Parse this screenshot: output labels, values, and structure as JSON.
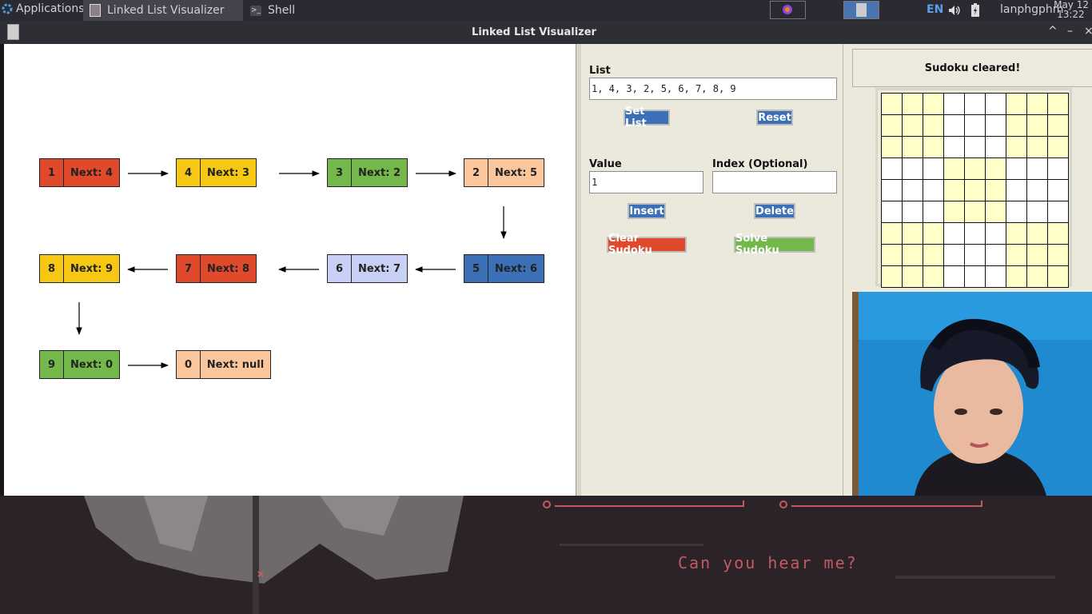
{
  "taskbar": {
    "apps_label": "Applications",
    "tasks": [
      {
        "label": "Linked List Visualizer"
      },
      {
        "label": "Shell"
      }
    ],
    "lang": "EN",
    "user": "lanphgphm",
    "date": "May 12",
    "time": "13:22"
  },
  "window": {
    "title": "Linked List Visualizer",
    "controls": [
      "^",
      "–",
      "×"
    ]
  },
  "canvas": {
    "nodes": [
      {
        "value": "1",
        "next": "Next: 4",
        "color": "#e0492c"
      },
      {
        "value": "4",
        "next": "Next: 3",
        "color": "#f6c814"
      },
      {
        "value": "3",
        "next": "Next: 2",
        "color": "#74b84b"
      },
      {
        "value": "2",
        "next": "Next: 5",
        "color": "#fcc69d"
      },
      {
        "value": "5",
        "next": "Next: 6",
        "color": "#3b70b7"
      },
      {
        "value": "6",
        "next": "Next: 7",
        "color": "#c8d0f5"
      },
      {
        "value": "7",
        "next": "Next: 8",
        "color": "#e0492c"
      },
      {
        "value": "8",
        "next": "Next: 9",
        "color": "#f6c814"
      },
      {
        "value": "9",
        "next": "Next: 0",
        "color": "#74b84b"
      },
      {
        "value": "0",
        "next": "Next: null",
        "color": "#fcc69d"
      }
    ]
  },
  "panel": {
    "list_label": "List",
    "list_value": "1, 4, 3, 2, 5, 6, 7, 8, 9",
    "set_list": "Set List",
    "reset": "Reset",
    "value_label": "Value",
    "value_value": "1",
    "index_label": "Index (Optional)",
    "index_value": "",
    "insert": "Insert",
    "delete": "Delete",
    "clear_sudoku": "Clear Sudoku",
    "solve_sudoku": "Solve Sudoku",
    "colors": {
      "blue": "#3b70b7",
      "red": "#e0492c",
      "green": "#74b84b"
    }
  },
  "right": {
    "status": "Sudoku cleared!"
  },
  "wallpaper": {
    "caption": "Can you hear me?"
  }
}
